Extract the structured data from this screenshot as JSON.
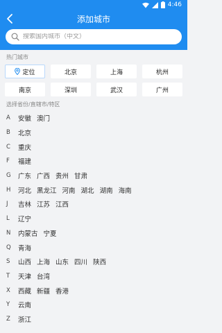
{
  "status": {
    "time": "4:46"
  },
  "header": {
    "title": "添加城市"
  },
  "search": {
    "placeholder": "搜索国内城市（中文）"
  },
  "hot": {
    "label": "热门城市",
    "cities": [
      "定位",
      "北京",
      "上海",
      "杭州",
      "南京",
      "深圳",
      "武汉",
      "广州"
    ]
  },
  "provinces_label": "选择省份/直辖市/特区",
  "provinces": [
    {
      "letter": "A",
      "names": [
        "安徽",
        "澳门"
      ]
    },
    {
      "letter": "B",
      "names": [
        "北京"
      ]
    },
    {
      "letter": "C",
      "names": [
        "重庆"
      ]
    },
    {
      "letter": "F",
      "names": [
        "福建"
      ]
    },
    {
      "letter": "G",
      "names": [
        "广东",
        "广西",
        "贵州",
        "甘肃"
      ]
    },
    {
      "letter": "H",
      "names": [
        "河北",
        "黑龙江",
        "河南",
        "湖北",
        "湖南",
        "海南"
      ]
    },
    {
      "letter": "J",
      "names": [
        "吉林",
        "江苏",
        "江西"
      ]
    },
    {
      "letter": "L",
      "names": [
        "辽宁"
      ]
    },
    {
      "letter": "N",
      "names": [
        "内蒙古",
        "宁夏"
      ]
    },
    {
      "letter": "Q",
      "names": [
        "青海"
      ]
    },
    {
      "letter": "S",
      "names": [
        "山西",
        "上海",
        "山东",
        "四川",
        "陕西"
      ]
    },
    {
      "letter": "T",
      "names": [
        "天津",
        "台湾"
      ]
    },
    {
      "letter": "X",
      "names": [
        "西藏",
        "新疆",
        "香港"
      ]
    },
    {
      "letter": "Y",
      "names": [
        "云南"
      ]
    },
    {
      "letter": "Z",
      "names": [
        "浙江"
      ]
    }
  ],
  "colors": {
    "accent": "#1f8cf0",
    "background": "#f2f3f5"
  }
}
